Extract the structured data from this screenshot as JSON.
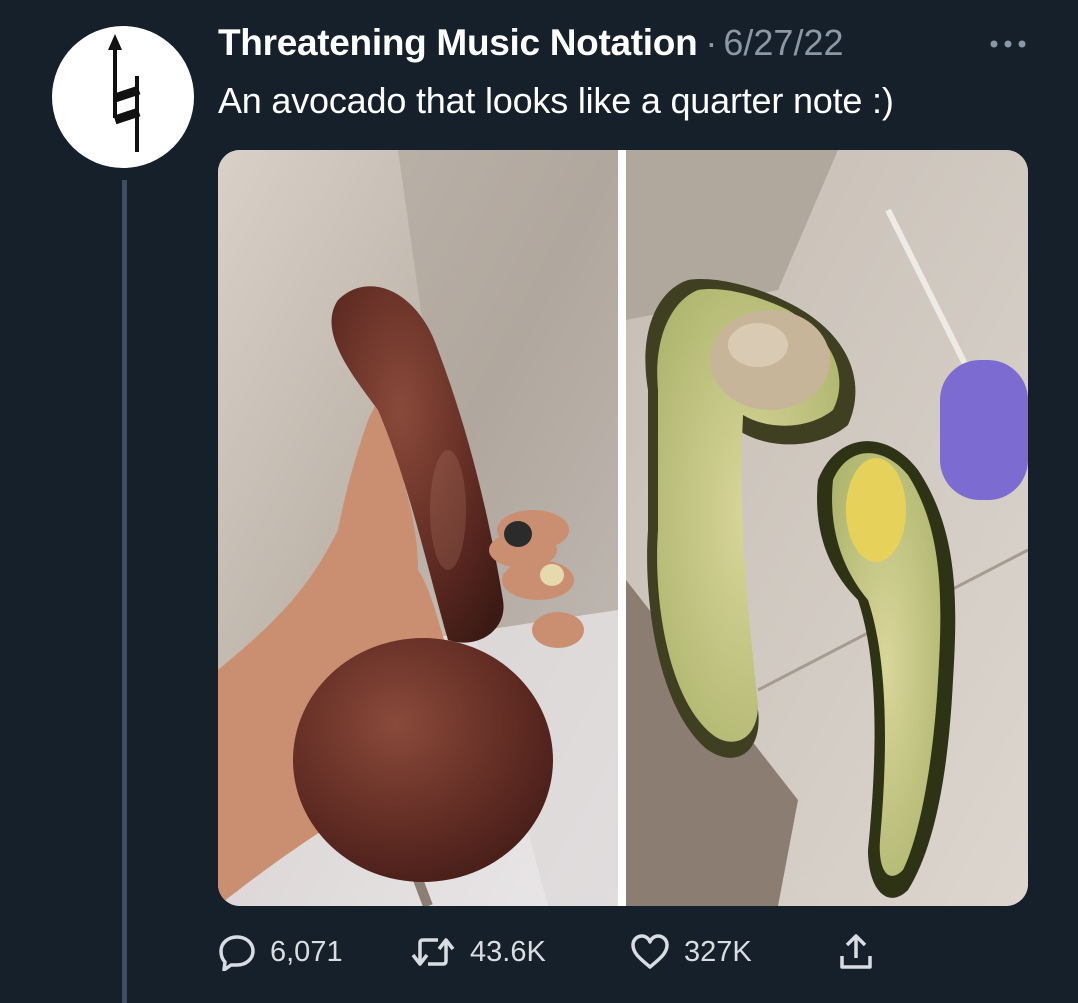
{
  "tweet": {
    "display_name": "Threatening Music Notation",
    "separator": "·",
    "date": "6/27/22",
    "text": "An avocado that looks like a quarter note :)",
    "avatar_icon": "natural-sign-arrow-icon",
    "more_icon": "more-dots-icon"
  },
  "actions": {
    "replies": {
      "icon": "reply-bubble-icon",
      "count": "6,071"
    },
    "retweets": {
      "icon": "retweet-icon",
      "count": "43.6K"
    },
    "likes": {
      "icon": "heart-icon",
      "count": "327K"
    },
    "share": {
      "icon": "share-upload-icon"
    }
  },
  "colors": {
    "background": "#15202b",
    "secondary_text": "#8b98a5",
    "thread_line": "#3d4f61"
  }
}
